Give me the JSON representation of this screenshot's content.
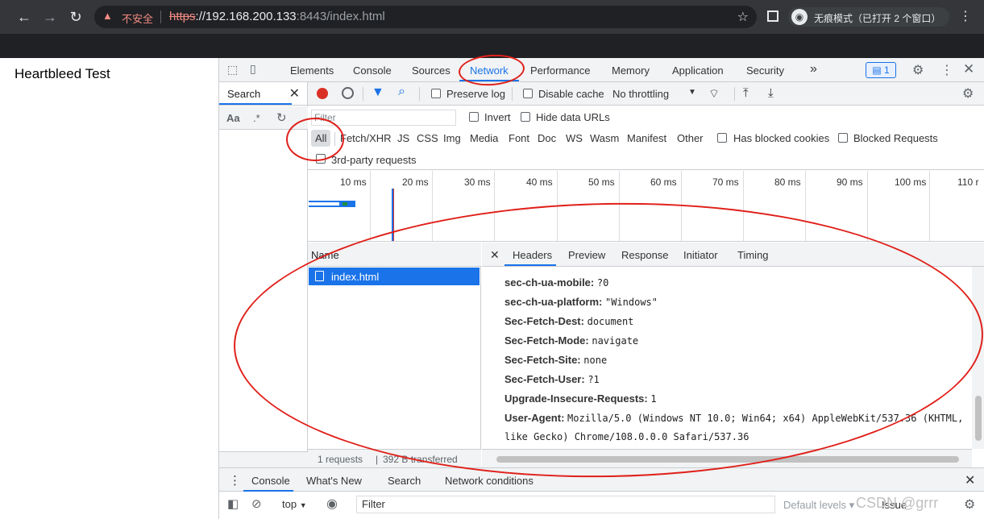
{
  "browser": {
    "insecure_label": "不安全",
    "url_scheme": "https",
    "url_host": "://192.168.200.133",
    "url_rest": ":8443/index.html",
    "incognito_label": "无痕模式（已打开 2 个窗口）"
  },
  "page": {
    "title": "Heartbleed Test"
  },
  "devtools": {
    "tabs": [
      "Elements",
      "Console",
      "Sources",
      "Network",
      "Performance",
      "Memory",
      "Application",
      "Security"
    ],
    "more": "»",
    "issues_count": "1",
    "search": {
      "label": "Search",
      "case": "Aa",
      "regex": ".*"
    },
    "toolbar": {
      "preserve_log": "Preserve log",
      "disable_cache": "Disable cache",
      "throttling": "No throttling"
    },
    "filter": {
      "placeholder": "Filter",
      "invert": "Invert",
      "hide_data_urls": "Hide data URLs",
      "types": [
        "All",
        "Fetch/XHR",
        "JS",
        "CSS",
        "Img",
        "Media",
        "Font",
        "Doc",
        "WS",
        "Wasm",
        "Manifest",
        "Other"
      ],
      "has_blocked_cookies": "Has blocked cookies",
      "blocked_requests": "Blocked Requests",
      "third_party": "3rd-party requests"
    },
    "timeline_ticks": [
      "10 ms",
      "20 ms",
      "30 ms",
      "40 ms",
      "50 ms",
      "60 ms",
      "70 ms",
      "80 ms",
      "90 ms",
      "100 ms",
      "110 r"
    ],
    "requests": {
      "column": "Name",
      "items": [
        "index.html"
      ],
      "count": "1 requests",
      "transferred": "392 B transferred"
    },
    "detail_tabs": [
      "Headers",
      "Preview",
      "Response",
      "Initiator",
      "Timing"
    ],
    "headers": [
      {
        "k": "sec-ch-ua-mobile:",
        "v": "?0"
      },
      {
        "k": "sec-ch-ua-platform:",
        "v": "\"Windows\""
      },
      {
        "k": "Sec-Fetch-Dest:",
        "v": "document"
      },
      {
        "k": "Sec-Fetch-Mode:",
        "v": "navigate"
      },
      {
        "k": "Sec-Fetch-Site:",
        "v": "none"
      },
      {
        "k": "Sec-Fetch-User:",
        "v": "?1"
      },
      {
        "k": "Upgrade-Insecure-Requests:",
        "v": "1"
      },
      {
        "k": "User-Agent:",
        "v": "Mozilla/5.0 (Windows NT 10.0; Win64; x64) AppleWebKit/537.36 (KHTML,"
      }
    ],
    "header_continuation": "like Gecko) Chrome/108.0.0.0 Safari/537.36",
    "drawer": {
      "tabs": [
        "Console",
        "What's New",
        "Search",
        "Network conditions"
      ],
      "context": "top",
      "filter_placeholder": "Filter",
      "levels": "Default levels",
      "issue": "Issue",
      "watermark": "CSDN @grrr"
    }
  }
}
